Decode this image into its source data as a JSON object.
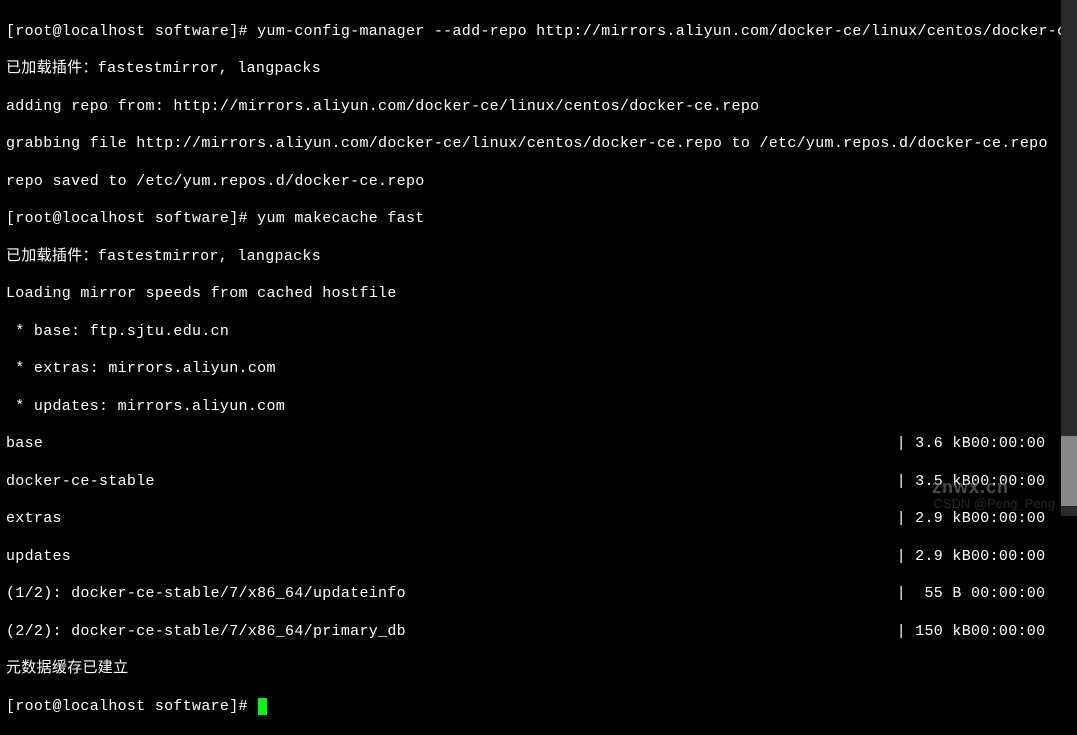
{
  "prompt1": "[root@localhost software]# ",
  "cmd1": "yum-config-manager --add-repo http://mirrors.aliyun.com/docker-ce/linux/centos/docker-ce.repo",
  "out1": "已加载插件：fastestmirror, langpacks",
  "out2": "adding repo from: http://mirrors.aliyun.com/docker-ce/linux/centos/docker-ce.repo",
  "out3": "grabbing file http://mirrors.aliyun.com/docker-ce/linux/centos/docker-ce.repo to /etc/yum.repos.d/docker-ce.repo",
  "out4": "repo saved to /etc/yum.repos.d/docker-ce.repo",
  "prompt2": "[root@localhost software]# ",
  "cmd2": "yum makecache fast",
  "out5": "已加载插件：fastestmirror, langpacks",
  "out6": "Loading mirror speeds from cached hostfile",
  "out7": " * base: ftp.sjtu.edu.cn",
  "out8": " * extras: mirrors.aliyun.com",
  "out9": " * updates: mirrors.aliyun.com",
  "repos": [
    {
      "name": "base",
      "size": "| 3.6 kB",
      "time": "00:00:00"
    },
    {
      "name": "docker-ce-stable",
      "size": "| 3.5 kB",
      "time": "00:00:00"
    },
    {
      "name": "extras",
      "size": "| 2.9 kB",
      "time": "00:00:00"
    },
    {
      "name": "updates",
      "size": "| 2.9 kB",
      "time": "00:00:00"
    }
  ],
  "downloads": [
    {
      "name": "(1/2): docker-ce-stable/7/x86_64/updateinfo",
      "size": "|  55 B ",
      "time": "00:00:00"
    },
    {
      "name": "(2/2): docker-ce-stable/7/x86_64/primary_db",
      "size": "| 150 kB",
      "time": "00:00:00"
    }
  ],
  "out10": "元数据缓存已建立",
  "prompt3": "[root@localhost software]# ",
  "wm1": "znwx.cn",
  "wm2": "CSDN @Peng_Peng"
}
